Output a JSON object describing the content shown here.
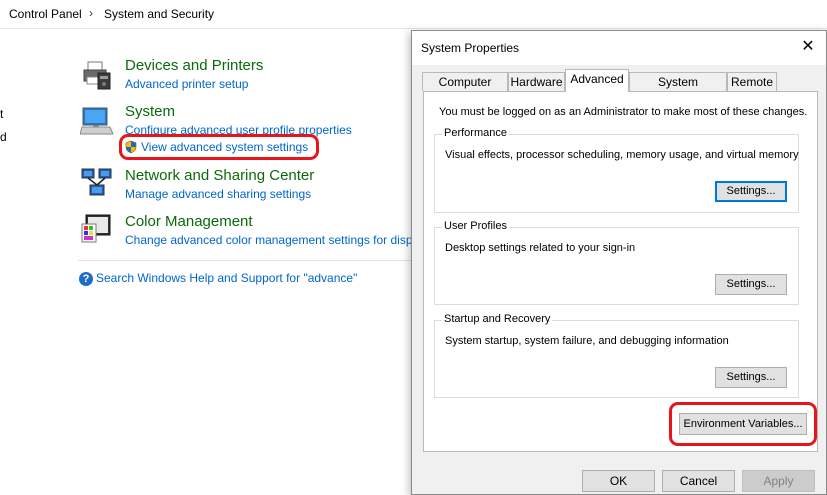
{
  "breadcrumb": {
    "items": [
      "Control Panel",
      "System and Security"
    ],
    "separator": "›"
  },
  "left_edge_fragments": [
    "t",
    "d"
  ],
  "control_panel": {
    "devices": {
      "title": "Devices and Printers",
      "links": [
        "Advanced printer setup"
      ],
      "icon": "printer-icon"
    },
    "system": {
      "title": "System",
      "links": [
        "Configure advanced user profile properties",
        "View advanced system settings"
      ],
      "icon": "computer-icon"
    },
    "network": {
      "title": "Network and Sharing Center",
      "links": [
        "Manage advanced sharing settings"
      ],
      "icon": "network-icon"
    },
    "color": {
      "title": "Color Management",
      "links": [
        "Change advanced color management settings for displ"
      ],
      "icon": "color-management-icon"
    },
    "help_link": "Search Windows Help and Support for \"advance\""
  },
  "dialog": {
    "title": "System Properties",
    "close_glyph": "✕",
    "tabs": [
      "Computer Name",
      "Hardware",
      "Advanced",
      "System Protection",
      "Remote"
    ],
    "active_tab": "Advanced",
    "admin_note": "You must be logged on as an Administrator to make most of these changes.",
    "groups": [
      {
        "label": "Performance",
        "description": "Visual effects, processor scheduling, memory usage, and virtual memory",
        "button": "Settings..."
      },
      {
        "label": "User Profiles",
        "description": "Desktop settings related to your sign-in",
        "button": "Settings..."
      },
      {
        "label": "Startup and Recovery",
        "description": "System startup, system failure, and debugging information",
        "button": "Settings..."
      }
    ],
    "env_button": "Environment Variables...",
    "buttons": {
      "ok": "OK",
      "cancel": "Cancel",
      "apply": "Apply"
    }
  },
  "colors": {
    "link": "#0066cc",
    "category_title": "#0b6a0b",
    "highlight": "#e8141c",
    "focus": "#0078d7"
  }
}
